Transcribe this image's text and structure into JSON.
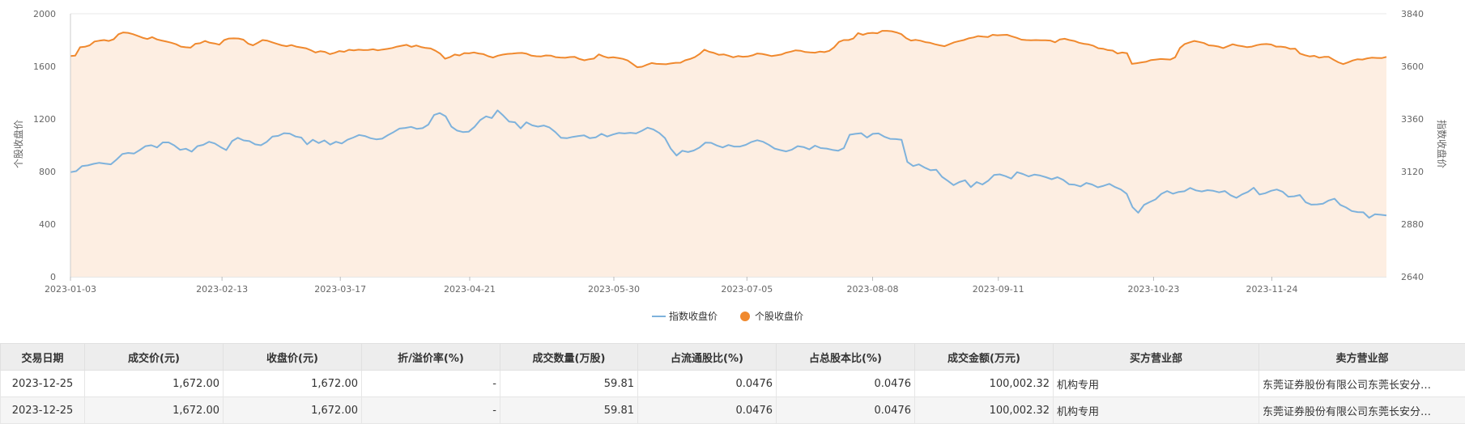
{
  "chart_data": {
    "type": "line",
    "xlabel": "",
    "ylabel_left": "个股收盘价",
    "ylabel_right": "指数收盘价",
    "yleft_lim": [
      0,
      2000
    ],
    "yleft_ticks": [
      0,
      400,
      800,
      1200,
      1600,
      2000
    ],
    "yright_lim": [
      2640,
      3840
    ],
    "yright_ticks": [
      2640,
      2880,
      3120,
      3360,
      3600,
      3840
    ],
    "x_ticks": [
      "2023-01-03",
      "2023-02-13",
      "2023-03-17",
      "2023-04-21",
      "2023-05-30",
      "2023-07-05",
      "2023-08-08",
      "2023-09-11",
      "2023-10-23",
      "2023-11-24"
    ],
    "x_range": [
      "2023-01-03",
      "2023-12-25"
    ],
    "grid": true,
    "legend_position": "bottom-center",
    "colors": {
      "index": "#7eb2dc",
      "stock": "#f0892e",
      "area": "#fdeee2"
    },
    "series": [
      {
        "name": "指数收盘价",
        "axis": "right",
        "values": [
          3117,
          3122,
          3145,
          3148,
          3155,
          3160,
          3156,
          3153,
          3175,
          3200,
          3205,
          3202,
          3218,
          3236,
          3240,
          3230,
          3253,
          3253,
          3239,
          3219,
          3224,
          3211,
          3236,
          3242,
          3256,
          3248,
          3232,
          3218,
          3259,
          3274,
          3262,
          3259,
          3244,
          3240,
          3255,
          3280,
          3283,
          3295,
          3293,
          3280,
          3275,
          3244,
          3265,
          3250,
          3262,
          3243,
          3256,
          3248,
          3265,
          3275,
          3287,
          3282,
          3272,
          3267,
          3270,
          3286,
          3300,
          3316,
          3319,
          3324,
          3315,
          3318,
          3334,
          3378,
          3387,
          3372,
          3325,
          3307,
          3300,
          3302,
          3324,
          3355,
          3372,
          3364,
          3399,
          3375,
          3348,
          3345,
          3317,
          3345,
          3331,
          3325,
          3330,
          3321,
          3300,
          3274,
          3272,
          3278,
          3282,
          3285,
          3272,
          3276,
          3292,
          3280,
          3289,
          3296,
          3294,
          3297,
          3294,
          3306,
          3320,
          3312,
          3296,
          3273,
          3225,
          3193,
          3215,
          3209,
          3216,
          3230,
          3252,
          3251,
          3239,
          3230,
          3241,
          3234,
          3234,
          3242,
          3255,
          3263,
          3256,
          3242,
          3225,
          3218,
          3212,
          3220,
          3236,
          3232,
          3221,
          3238,
          3227,
          3225,
          3219,
          3215,
          3227,
          3288,
          3292,
          3295,
          3275,
          3292,
          3294,
          3279,
          3269,
          3268,
          3265,
          3164,
          3145,
          3153,
          3138,
          3126,
          3128,
          3096,
          3078,
          3058,
          3072,
          3080,
          3049,
          3072,
          3061,
          3078,
          3104,
          3107,
          3099,
          3088,
          3117,
          3109,
          3098,
          3106,
          3102,
          3094,
          3085,
          3094,
          3082,
          3062,
          3060,
          3052,
          3068,
          3061,
          3048,
          3055,
          3064,
          3049,
          3038,
          3018,
          2958,
          2932,
          2968,
          2981,
          2993,
          3018,
          3031,
          3019,
          3027,
          3030,
          3045,
          3034,
          3029,
          3035,
          3032,
          3025,
          3031,
          3012,
          3000,
          3016,
          3027,
          3046,
          3015,
          3021,
          3032,
          3038,
          3028,
          3005,
          3007,
          3013,
          2980,
          2969,
          2970,
          2973,
          2988,
          2996,
          2968,
          2956,
          2940,
          2935,
          2934,
          2909,
          2925,
          2923,
          2920
        ]
      },
      {
        "name": "个股收盘价",
        "axis": "left",
        "values": [
          1678,
          1681,
          1745,
          1749,
          1760,
          1789,
          1795,
          1800,
          1793,
          1806,
          1844,
          1858,
          1855,
          1845,
          1832,
          1818,
          1808,
          1822,
          1805,
          1796,
          1788,
          1780,
          1768,
          1750,
          1745,
          1742,
          1772,
          1776,
          1793,
          1780,
          1774,
          1765,
          1800,
          1812,
          1813,
          1812,
          1803,
          1773,
          1760,
          1779,
          1800,
          1795,
          1783,
          1771,
          1760,
          1753,
          1762,
          1750,
          1744,
          1738,
          1724,
          1705,
          1715,
          1710,
          1693,
          1703,
          1716,
          1711,
          1726,
          1722,
          1727,
          1724,
          1725,
          1730,
          1722,
          1728,
          1733,
          1740,
          1750,
          1757,
          1764,
          1748,
          1759,
          1747,
          1740,
          1736,
          1719,
          1696,
          1658,
          1670,
          1690,
          1683,
          1701,
          1699,
          1706,
          1698,
          1693,
          1677,
          1667,
          1681,
          1689,
          1695,
          1697,
          1701,
          1702,
          1696,
          1681,
          1677,
          1676,
          1683,
          1682,
          1670,
          1667,
          1665,
          1671,
          1672,
          1656,
          1646,
          1654,
          1659,
          1691,
          1676,
          1665,
          1669,
          1664,
          1657,
          1645,
          1620,
          1593,
          1597,
          1612,
          1625,
          1619,
          1618,
          1616,
          1622,
          1627,
          1628,
          1646,
          1656,
          1670,
          1694,
          1727,
          1711,
          1702,
          1688,
          1691,
          1681,
          1669,
          1678,
          1673,
          1675,
          1684,
          1698,
          1695,
          1687,
          1678,
          1684,
          1690,
          1704,
          1712,
          1722,
          1719,
          1709,
          1706,
          1704,
          1712,
          1708,
          1718,
          1745,
          1786,
          1800,
          1800,
          1812,
          1853,
          1840,
          1852,
          1855,
          1852,
          1870,
          1870,
          1867,
          1858,
          1845,
          1815,
          1796,
          1801,
          1795,
          1784,
          1779,
          1768,
          1760,
          1753,
          1768,
          1783,
          1792,
          1800,
          1813,
          1820,
          1830,
          1826,
          1823,
          1840,
          1836,
          1838,
          1840,
          1828,
          1817,
          1803,
          1800,
          1799,
          1800,
          1798,
          1799,
          1796,
          1783,
          1805,
          1810,
          1800,
          1793,
          1780,
          1772,
          1767,
          1756,
          1738,
          1734,
          1724,
          1720,
          1698,
          1705,
          1700,
          1619,
          1624,
          1630,
          1636,
          1648,
          1652,
          1656,
          1654,
          1652,
          1669,
          1740,
          1770,
          1782,
          1793,
          1786,
          1777,
          1760,
          1757,
          1751,
          1739,
          1753,
          1768,
          1759,
          1753,
          1746,
          1750,
          1761,
          1768,
          1770,
          1766,
          1750,
          1750,
          1745,
          1733,
          1735,
          1697,
          1685,
          1676,
          1680,
          1666,
          1672,
          1672,
          1650,
          1631,
          1617,
          1630,
          1645,
          1654,
          1652,
          1661,
          1666,
          1664,
          1663,
          1672
        ]
      }
    ]
  },
  "table": {
    "headers": [
      "交易日期",
      "成交价(元)",
      "收盘价(元)",
      "折/溢价率(%)",
      "成交数量(万股)",
      "占流通股比(%)",
      "占总股本比(%)",
      "成交金额(万元)",
      "买方营业部",
      "卖方营业部"
    ],
    "rows": [
      [
        "2023-12-25",
        "1,672.00",
        "1,672.00",
        "-",
        "59.81",
        "0.0476",
        "0.0476",
        "100,002.32",
        "机构专用",
        "东莞证券股份有限公司东莞长安分…"
      ],
      [
        "2023-12-25",
        "1,672.00",
        "1,672.00",
        "-",
        "59.81",
        "0.0476",
        "0.0476",
        "100,002.32",
        "机构专用",
        "东莞证券股份有限公司东莞长安分…"
      ]
    ]
  }
}
